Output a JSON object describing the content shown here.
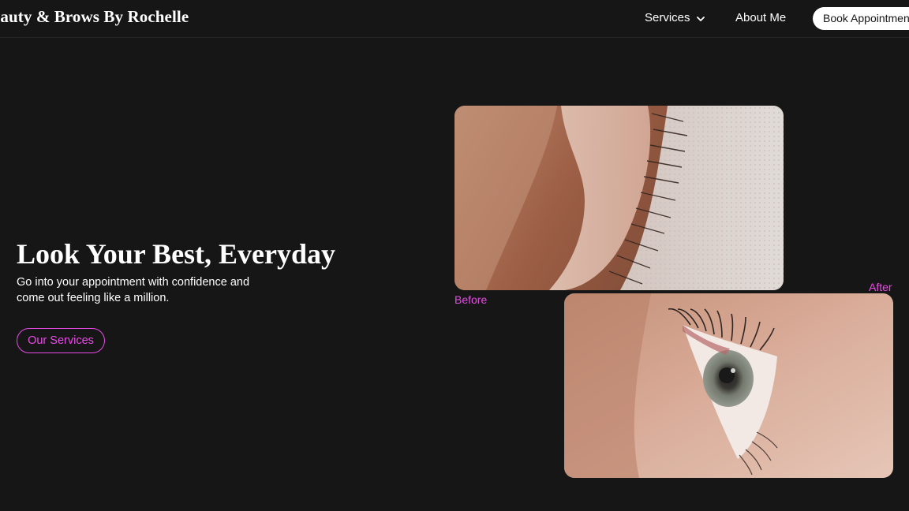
{
  "header": {
    "brand": "eauty & Brows By Rochelle",
    "nav": {
      "services_label": "Services",
      "about_label": "About Me",
      "book_label": "Book Appointment"
    }
  },
  "hero": {
    "title": "Look Your Best, Everyday",
    "subtitle": "Go into your appointment with confidence and come out feeling like a million.",
    "cta_label": "Our Services"
  },
  "gallery": {
    "before_label": "Before",
    "after_label": "After"
  },
  "colors": {
    "background": "#171617",
    "accent": "#e84be6",
    "text": "#ffffff"
  },
  "icons": {
    "services_dropdown": "chevron-down-icon"
  }
}
